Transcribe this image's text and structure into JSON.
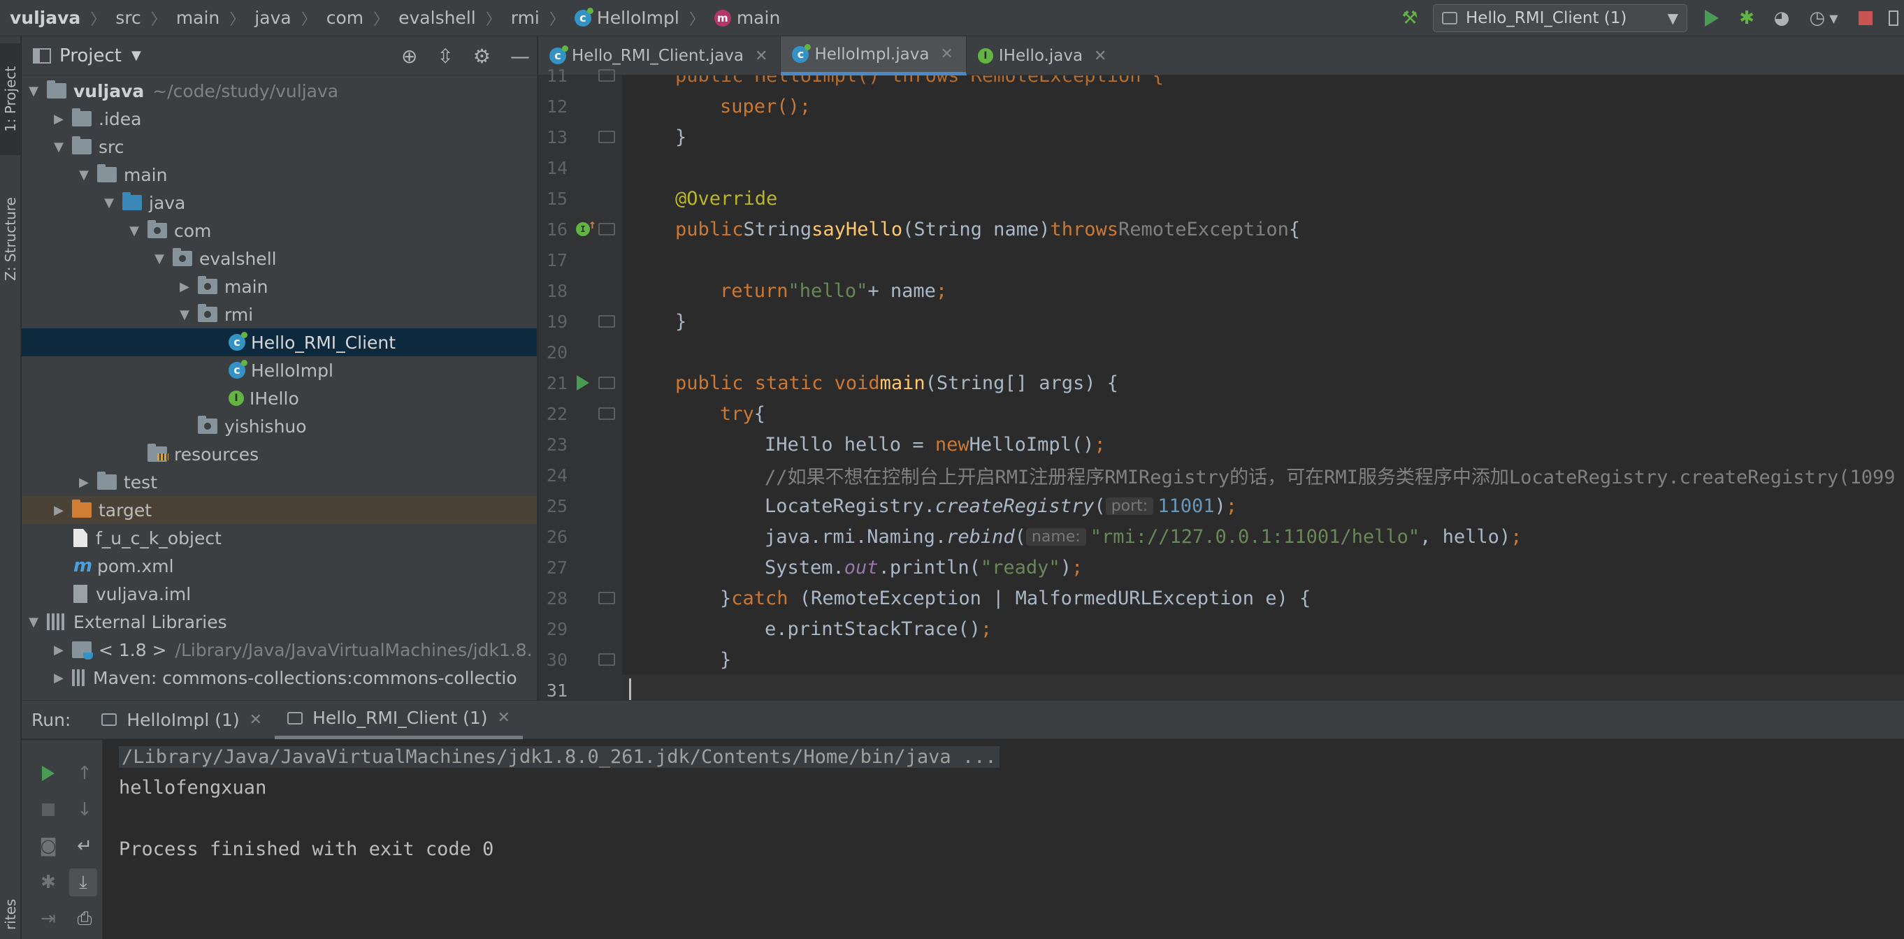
{
  "navbar": {
    "breadcrumb": [
      "vuljava",
      "src",
      "main",
      "java",
      "com",
      "evalshell",
      "rmi",
      "HelloImpl",
      "main"
    ],
    "run_config": "Hello_RMI_Client (1)"
  },
  "left_strip": {
    "project_tab": "1: Project",
    "structure_tab": "Z: Structure",
    "favorites_tab": "rites"
  },
  "project": {
    "title": "Project",
    "tree": [
      {
        "label": "vuljava",
        "path": "~/code/study/vuljava"
      },
      {
        "label": ".idea"
      },
      {
        "label": "src"
      },
      {
        "label": "main"
      },
      {
        "label": "java"
      },
      {
        "label": "com"
      },
      {
        "label": "evalshell"
      },
      {
        "label": "main"
      },
      {
        "label": "rmi"
      },
      {
        "label": "Hello_RMI_Client"
      },
      {
        "label": "HelloImpl"
      },
      {
        "label": "IHello"
      },
      {
        "label": "yishishuo"
      },
      {
        "label": "resources"
      },
      {
        "label": "test"
      },
      {
        "label": "target"
      },
      {
        "label": "f_u_c_k_object"
      },
      {
        "label": "pom.xml"
      },
      {
        "label": "vuljava.iml"
      },
      {
        "label": "External Libraries"
      },
      {
        "label": "< 1.8 >",
        "path": "/Library/Java/JavaVirtualMachines/jdk1.8."
      },
      {
        "label": "Maven: commons-collections:commons-collectio"
      }
    ]
  },
  "editor": {
    "tabs": [
      "Hello_RMI_Client.java",
      "HelloImpl.java",
      "IHello.java"
    ],
    "active_tab": "HelloImpl.java",
    "line_numbers": [
      "11",
      "12",
      "13",
      "14",
      "15",
      "16",
      "17",
      "18",
      "19",
      "20",
      "21",
      "22",
      "23",
      "24",
      "25",
      "26",
      "27",
      "28",
      "29",
      "30",
      "31"
    ],
    "code": {
      "l11": "public HelloImpl() throws RemoteException {",
      "l12": "super();",
      "l13": "}",
      "l15": "@Override",
      "l16": {
        "kw": "public",
        "type": "String",
        "fn": "sayHello",
        "params": "(String name)",
        "throws": "throws",
        "exc": "RemoteException",
        "brace": "{"
      },
      "l18": {
        "kw": "return",
        "str": "\"hello\"",
        "rest": "+ name",
        "semi": ";"
      },
      "l19": "}",
      "l21": {
        "kw": "public static void",
        "fn": "main",
        "rest": "(String[] args) {"
      },
      "l22": {
        "kw": "try",
        "rest": "{"
      },
      "l23": {
        "a": "IHello hello = ",
        "kw": "new",
        "b": "HelloImpl()",
        "semi": ";"
      },
      "l24": "//如果不想在控制台上开启RMI注册程序RMIRegistry的话，可在RMI服务类程序中添加LocateRegistry.createRegistry(1099",
      "l25": {
        "a": "LocateRegistry.",
        "m": "createRegistry",
        "b": "(",
        "hint": "port:",
        "num": "11001",
        "c": ")",
        "semi": ";"
      },
      "l26": {
        "a": "java.rmi.Naming.",
        "m": "rebind",
        "b": "(",
        "hint": "name:",
        "str": "\"rmi://127.0.0.1:11001/hello\"",
        "c": ", hello)",
        "semi": ";"
      },
      "l27": {
        "a": "System.",
        "m": "out",
        "b": ".println(",
        "str": "\"ready\"",
        "c": ")",
        "semi": ";"
      },
      "l28": {
        "a": "}",
        "kw": "catch",
        "b": " (RemoteException | MalformedURLException e) {"
      },
      "l29": {
        "a": "e.printStackTrace()",
        "semi": ";"
      },
      "l30": "}"
    }
  },
  "run": {
    "label": "Run:",
    "tabs": [
      "HelloImpl (1)",
      "Hello_RMI_Client (1)"
    ],
    "active_tab": "Hello_RMI_Client (1)",
    "console": {
      "command": "/Library/Java/JavaVirtualMachines/jdk1.8.0_261.jdk/Contents/Home/bin/java ...",
      "output": "hellofengxuan",
      "exit": "Process finished with exit code 0"
    }
  },
  "colors": {
    "accent": "#4a88c7",
    "keyword": "#cc7832",
    "string": "#6a8759",
    "number": "#6897bb",
    "function": "#ffc66d",
    "annotation": "#bbb529",
    "selection": "#0d293e",
    "run_green": "#499c54",
    "stop_red": "#c75450"
  },
  "icons": [
    "hammer-icon",
    "run-icon",
    "debug-icon",
    "coverage-icon",
    "profile-icon",
    "stop-icon",
    "target-icon",
    "collapse-icon",
    "gear-icon",
    "minimize-icon"
  ]
}
